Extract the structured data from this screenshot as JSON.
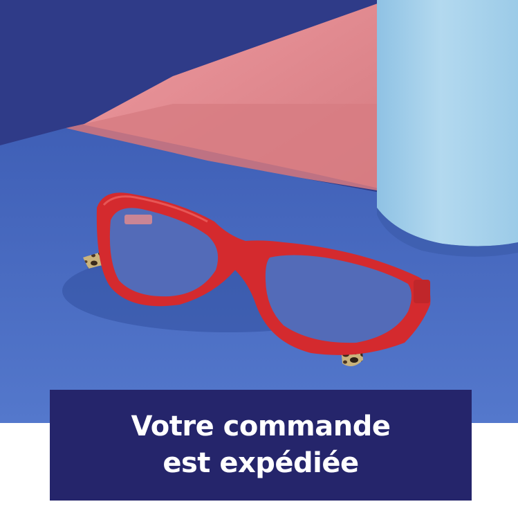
{
  "banner": {
    "line1": "Votre commande",
    "line2": "est expédiée"
  },
  "photo": {
    "subject": "red-cat-eye-eyeglasses",
    "colors": {
      "table_blue": "#4a6fc2",
      "back_wall": "#2e3a86",
      "pink_light": "#e58a8f",
      "cylinder_blue": "#a7d2ec",
      "frame_red": "#d42a2e",
      "tortoise_dark": "#3a2a1c",
      "tortoise_light": "#c8b27a",
      "banner_navy": "#25256b"
    }
  }
}
